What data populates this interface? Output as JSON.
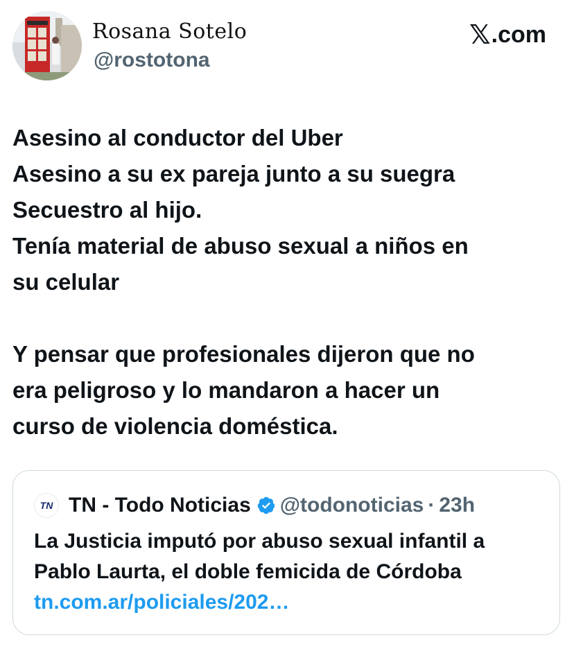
{
  "author": {
    "display_name": "Rosana Sotelo",
    "handle": "@rostotona",
    "avatar_icon": "profile-photo-telephone-booth"
  },
  "brand": {
    "x_glyph": "𝕏",
    "suffix": ".com"
  },
  "tweet": {
    "lines": [
      "Asesino al conductor del Uber",
      "Asesino a su ex pareja junto a su suegra",
      "Secuestro al hijo.",
      "Tenía material de abuso sexual a niños en",
      "su celular",
      "",
      "Y pensar que profesionales dijeron que no",
      "era peligroso y lo mandaron a hacer un",
      "curso de violencia doméstica."
    ]
  },
  "quoted": {
    "logo_text": "TN",
    "name": "TN - Todo Noticias",
    "handle": "@todonoticias",
    "separator": "·",
    "time": "23h",
    "text_lines": [
      "La Justicia imputó por abuso sexual infantil a",
      "Pablo Laurta, el doble femicida de Córdoba"
    ],
    "link": "tn.com.ar/policiales/202…",
    "verified_color": "#1d9bf0"
  },
  "colors": {
    "text": "#0f1419",
    "secondary": "#536471",
    "link": "#1d9bf0",
    "border": "#cfd9de"
  }
}
